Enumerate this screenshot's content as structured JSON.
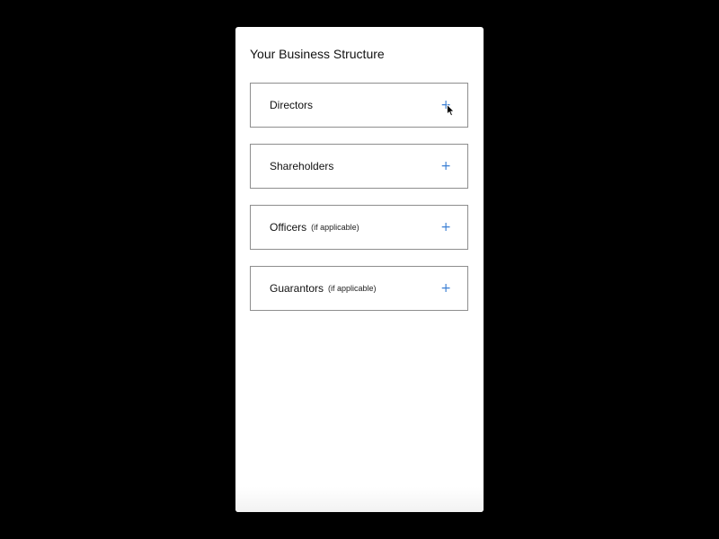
{
  "panel": {
    "title": "Your Business Structure"
  },
  "sections": [
    {
      "label": "Directors",
      "note": "",
      "icon": "plus-icon",
      "icon_glyph": "+"
    },
    {
      "label": "Shareholders",
      "note": "",
      "icon": "plus-icon",
      "icon_glyph": "+"
    },
    {
      "label": "Officers",
      "note": "(if applicable)",
      "icon": "plus-icon",
      "icon_glyph": "+"
    },
    {
      "label": "Guarantors",
      "note": "(if applicable)",
      "icon": "plus-icon",
      "icon_glyph": "+"
    }
  ],
  "colors": {
    "background": "#000000",
    "panel": "#ffffff",
    "border": "#8e8e8e",
    "accent": "#3b7fd4"
  }
}
